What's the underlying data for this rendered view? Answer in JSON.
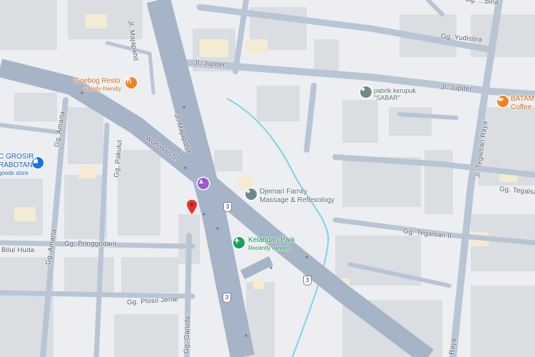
{
  "map": {
    "colors": {
      "background": "#eceef1",
      "building": "#dadde2",
      "major_road": "#a6b4c7",
      "minor_road": "#b9c5d5",
      "water": "#7fd3e8",
      "food_poi": "#f2821f",
      "poi_grey": "#6f8a8a",
      "park_poi": "#1f9e5a",
      "shop_poi": "#1a73e8",
      "hotel_poi": "#9b59d0",
      "marker": "#e5302b"
    },
    "roads": {
      "jl_majapahit_top": "Jl. Majapahit",
      "jl_majapahit_mid": "Jl. Majapahit",
      "jl_jupiter_left": "Jl. Jupiter",
      "jl_jupiter_right": "Jl. Jupiter",
      "wonosari": "Wonosari St",
      "gg_amarta_top": "Gg. Amarta",
      "gg_amarta_bottom": "Gg. Amarta",
      "gg_pakulit": "Gg. Pakulut",
      "gg_pringgodani": "Gg. Pringgodani",
      "gg_ploso": "Gg. Ploso Jenar",
      "gg_garuda": "Gg. Garuda",
      "gg_yudistira": "Gg. Yudistira",
      "jl_tegalsari_raya": "Jl. Tegalsari Raya",
      "gg_tegalsari": "Gg. Tegalsari",
      "gg_tegalsari_ii": "Gg. Tegalsari II",
      "bilul_huda": "Bilul Huda",
      "gg_top_right": "Gg. ...bina",
      "raya_bottom": "Raya"
    },
    "pois": {
      "goebog": {
        "name": "Goebog Resto",
        "sub": "Family-friendly",
        "icon": "fork-knife-icon"
      },
      "kerupuk": {
        "name": "pabrik kerupuk \"SABAR\"",
        "icon": "location-icon"
      },
      "batam": {
        "name": "BATAM",
        "sub": "Coffee",
        "icon": "coffee-icon"
      },
      "djemari": {
        "name": "Djemari Family",
        "name2": "Massage & Reflexology",
        "icon": "spa-icon"
      },
      "kelandan": {
        "name": "Kelandan Park",
        "sub": "Recently viewed",
        "icon": "tree-icon"
      },
      "grosir": {
        "name": "C GROSIR",
        "name2": "RABOTAN",
        "sub": "goods store",
        "icon": "shopping-bag-icon"
      },
      "hotel": {
        "icon": "hotel-icon"
      }
    },
    "shield_number": "3"
  }
}
